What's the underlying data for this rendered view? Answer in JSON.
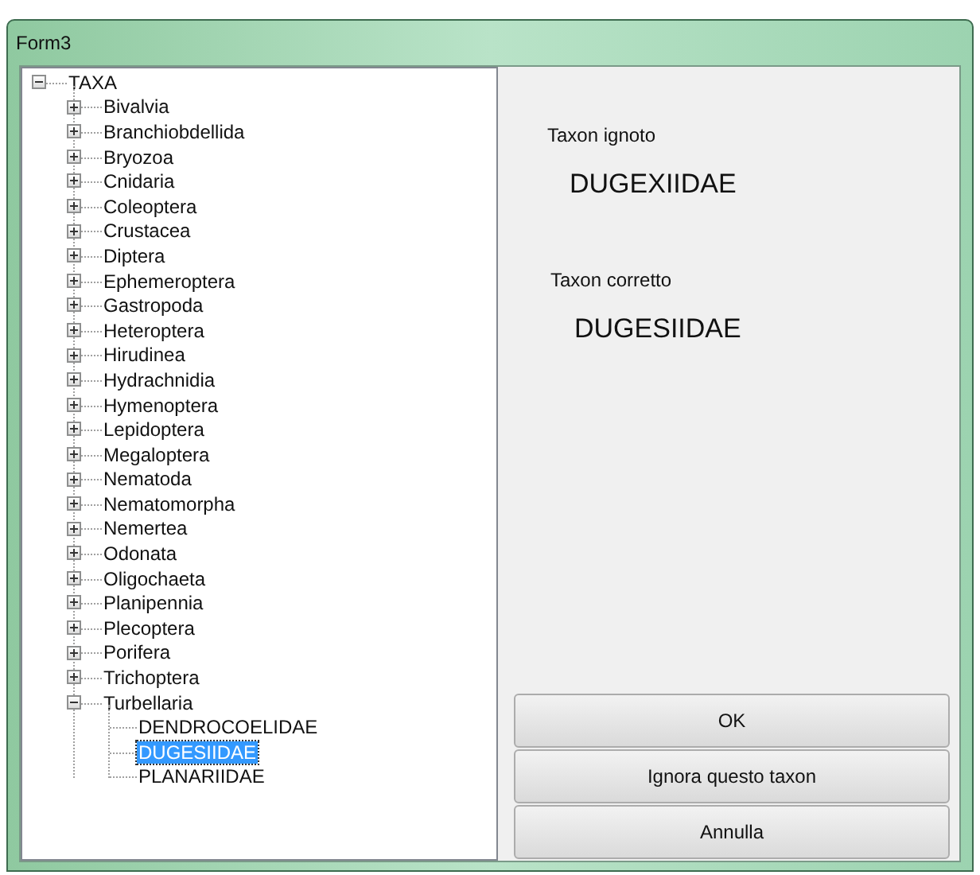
{
  "window": {
    "title": "Form3"
  },
  "tree": [
    {
      "label": "TAXA",
      "expanded": true,
      "selected": false,
      "children": [
        {
          "label": "Bivalvia",
          "expanded": false,
          "selected": false
        },
        {
          "label": "Branchiobdellida",
          "expanded": false,
          "selected": false
        },
        {
          "label": "Bryozoa",
          "expanded": false,
          "selected": false
        },
        {
          "label": "Cnidaria",
          "expanded": false,
          "selected": false
        },
        {
          "label": "Coleoptera",
          "expanded": false,
          "selected": false
        },
        {
          "label": "Crustacea",
          "expanded": false,
          "selected": false
        },
        {
          "label": "Diptera",
          "expanded": false,
          "selected": false
        },
        {
          "label": "Ephemeroptera",
          "expanded": false,
          "selected": false
        },
        {
          "label": "Gastropoda",
          "expanded": false,
          "selected": false
        },
        {
          "label": "Heteroptera",
          "expanded": false,
          "selected": false
        },
        {
          "label": "Hirudinea",
          "expanded": false,
          "selected": false
        },
        {
          "label": "Hydrachnidia",
          "expanded": false,
          "selected": false
        },
        {
          "label": "Hymenoptera",
          "expanded": false,
          "selected": false
        },
        {
          "label": "Lepidoptera",
          "expanded": false,
          "selected": false
        },
        {
          "label": "Megaloptera",
          "expanded": false,
          "selected": false
        },
        {
          "label": "Nematoda",
          "expanded": false,
          "selected": false
        },
        {
          "label": "Nematomorpha",
          "expanded": false,
          "selected": false
        },
        {
          "label": "Nemertea",
          "expanded": false,
          "selected": false
        },
        {
          "label": "Odonata",
          "expanded": false,
          "selected": false
        },
        {
          "label": "Oligochaeta",
          "expanded": false,
          "selected": false
        },
        {
          "label": "Planipennia",
          "expanded": false,
          "selected": false
        },
        {
          "label": "Plecoptera",
          "expanded": false,
          "selected": false
        },
        {
          "label": "Porifera",
          "expanded": false,
          "selected": false
        },
        {
          "label": "Trichoptera",
          "expanded": false,
          "selected": false
        },
        {
          "label": "Turbellaria",
          "expanded": true,
          "selected": false,
          "children": [
            {
              "label": "DENDROCOELIDAE",
              "selected": false
            },
            {
              "label": "DUGESIIDAE",
              "selected": true
            },
            {
              "label": "PLANARIIDAE",
              "selected": false
            }
          ]
        }
      ]
    }
  ],
  "unknown": {
    "label": "Taxon ignoto",
    "value": "DUGEXIIDAE"
  },
  "correct": {
    "label": "Taxon corretto",
    "value": "DUGESIIDAE"
  },
  "buttons": [
    "OK",
    "Ignora questo taxon",
    "Annulla"
  ]
}
